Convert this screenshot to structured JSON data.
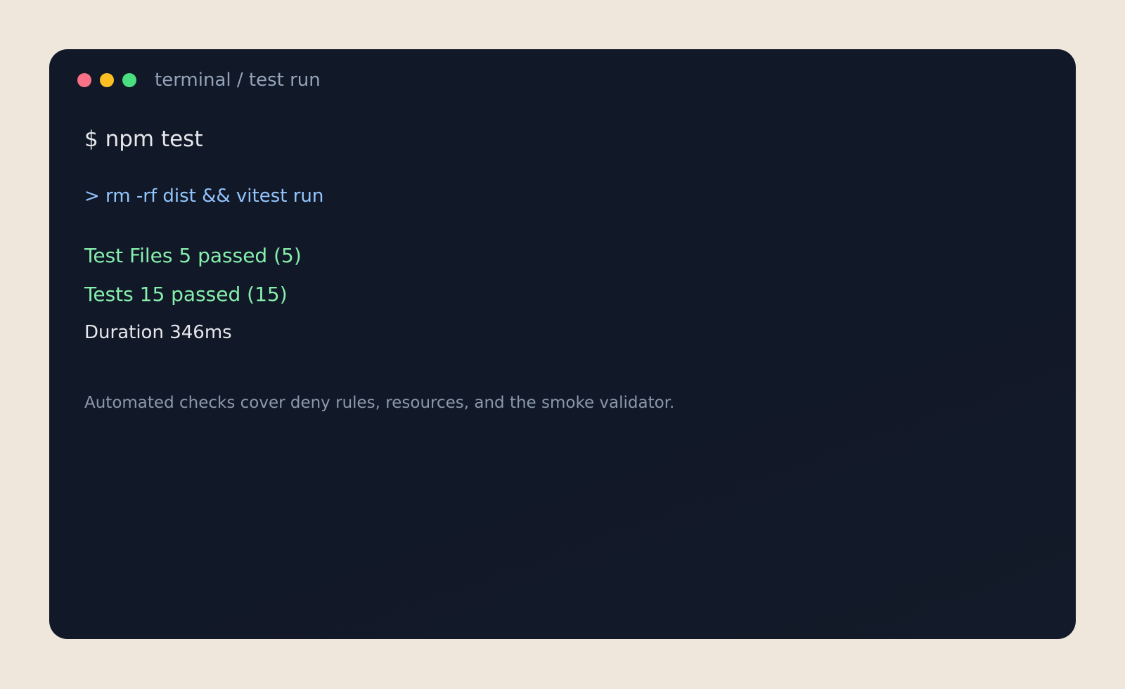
{
  "window": {
    "title": "terminal / test run",
    "controls": [
      "close",
      "minimize",
      "maximize"
    ],
    "colors": {
      "background": "#111827",
      "close": "#f87186",
      "minimize": "#fbbf24",
      "maximize": "#4ade80"
    }
  },
  "terminal": {
    "command": "$ npm test",
    "script": "> rm -rf dist && vitest run",
    "test_files": "Test Files 5 passed (5)",
    "tests": "Tests 15 passed (15)",
    "duration": "Duration 346ms",
    "note": "Automated checks cover deny rules, resources, and the smoke validator."
  }
}
